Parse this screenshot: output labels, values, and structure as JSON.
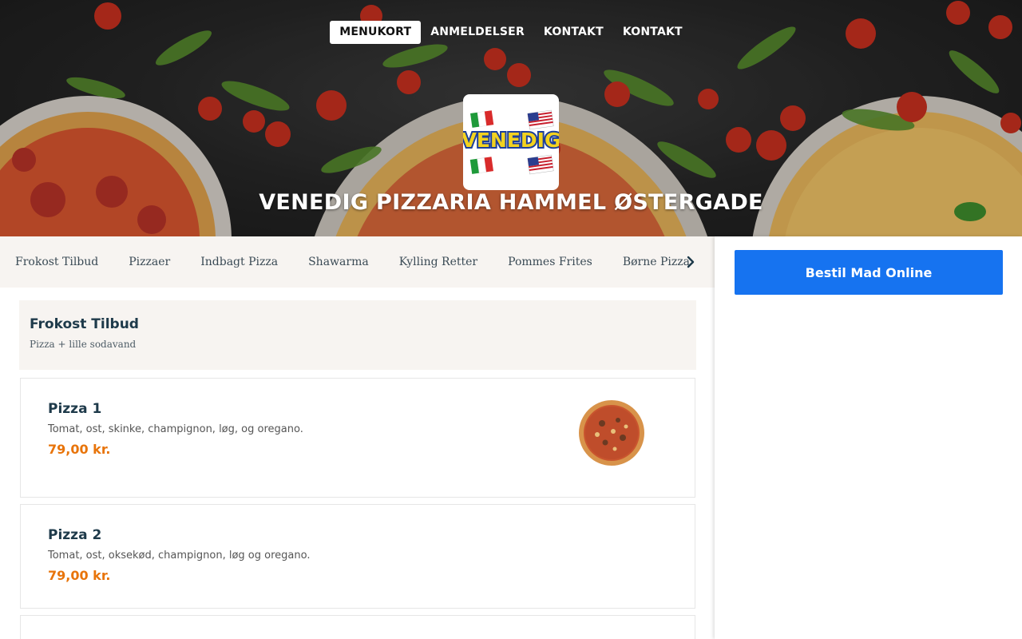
{
  "nav": {
    "items": [
      {
        "label": "MENUKORT",
        "active": true
      },
      {
        "label": "ANMELDELSER",
        "active": false
      },
      {
        "label": "KONTAKT",
        "active": false
      },
      {
        "label": "KONTAKT",
        "active": false
      }
    ]
  },
  "hero": {
    "logo_text": "VENEDIG",
    "title": "VENEDIG PIZZARIA HAMMEL ØSTERGADE"
  },
  "categories": [
    "Frokost Tilbud",
    "Pizzaer",
    "Indbagt Pizza",
    "Shawarma",
    "Kylling Retter",
    "Pommes Frites",
    "Børne Pizza"
  ],
  "category_icons": {
    "next": "chevron-right-icon"
  },
  "sidebar": {
    "order_button": "Bestil Mad Online"
  },
  "section": {
    "title": "Frokost Tilbud",
    "subtitle": "Pizza + lille sodavand"
  },
  "items": [
    {
      "name": "Pizza 1",
      "description": "Tomat, ost, skinke, champignon, løg, og oregano.",
      "price": "79,00 kr.",
      "has_image": true
    },
    {
      "name": "Pizza 2",
      "description": "Tomat, ost, oksekød, champignon, løg og oregano.",
      "price": "79,00 kr.",
      "has_image": false
    }
  ],
  "colors": {
    "accent": "#1673f0",
    "price": "#e8740a",
    "heading": "#1e3a4a",
    "panel": "#f7f4f1"
  }
}
